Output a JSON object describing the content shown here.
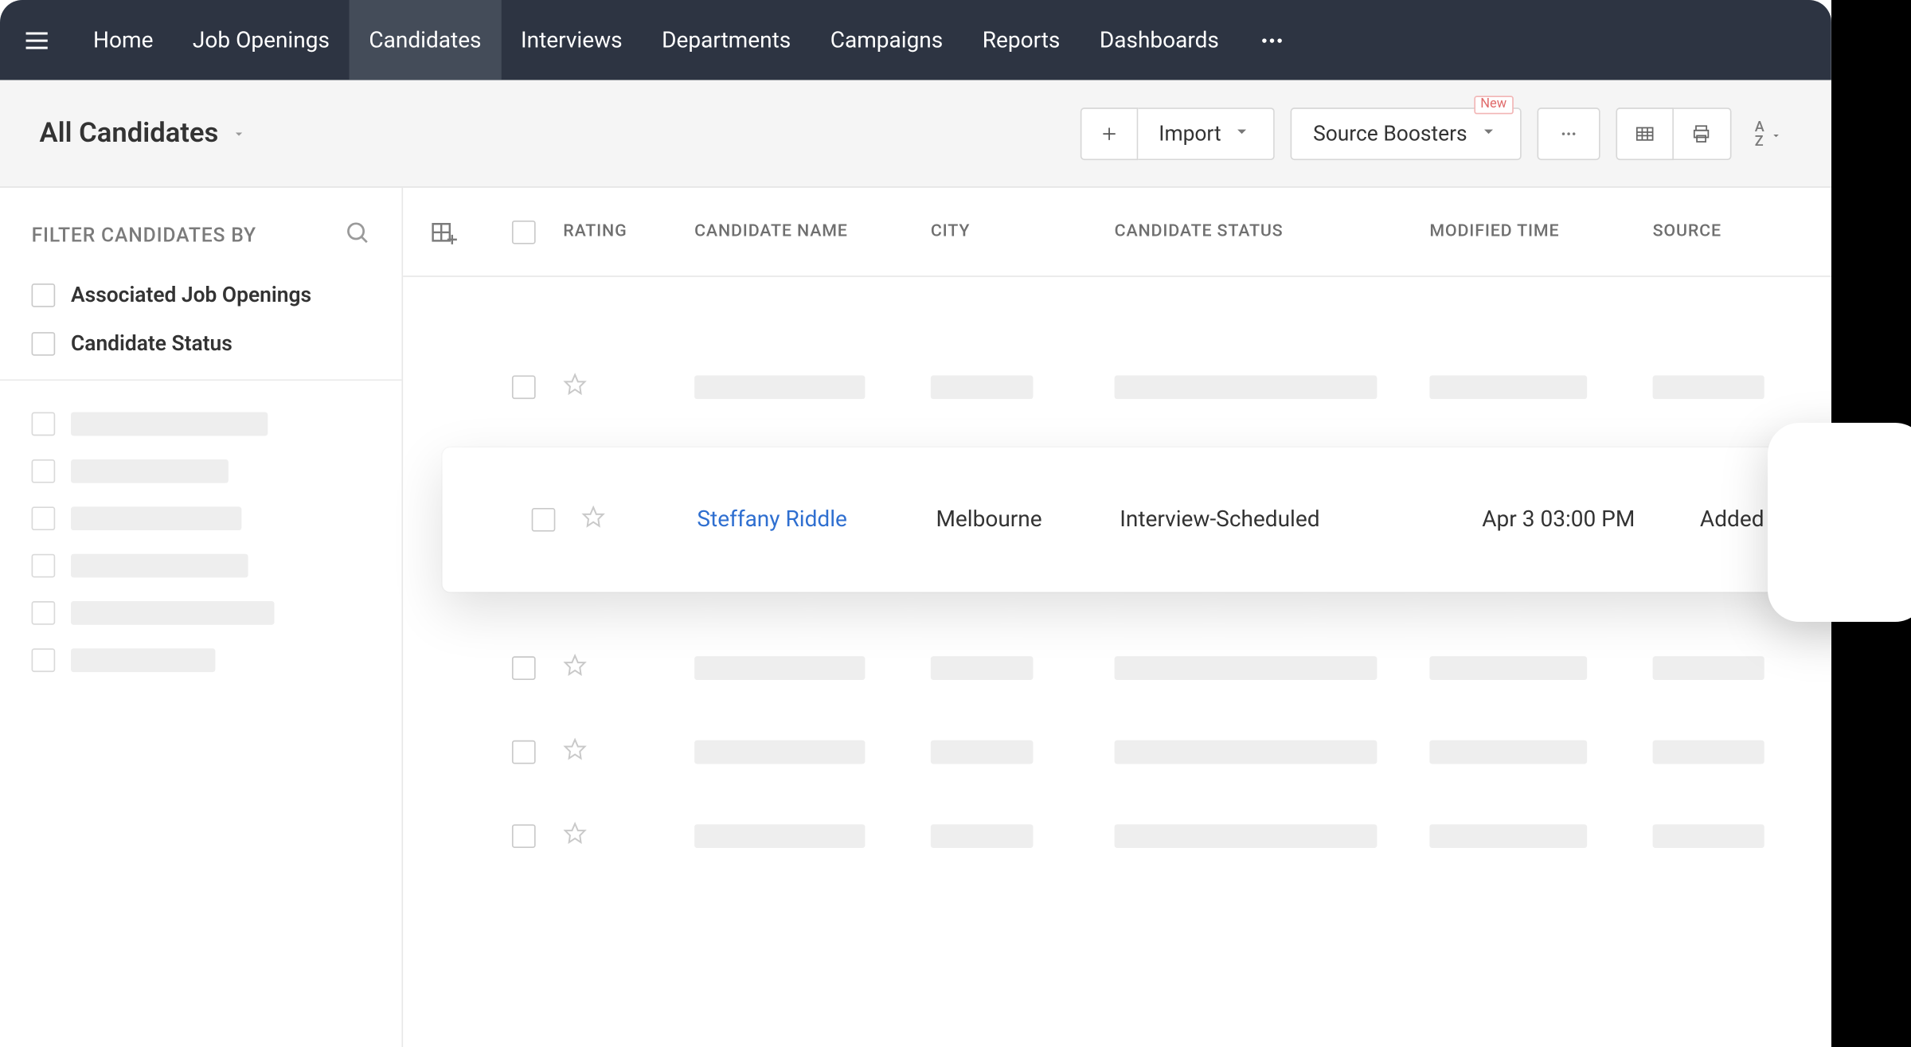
{
  "nav": {
    "items": [
      "Home",
      "Job Openings",
      "Candidates",
      "Interviews",
      "Departments",
      "Campaigns",
      "Reports",
      "Dashboards"
    ],
    "active_index": 2
  },
  "toolbar": {
    "view_title": "All Candidates",
    "import_label": "Import",
    "source_boosters_label": "Source Boosters",
    "new_badge": "New"
  },
  "sidebar": {
    "title": "FILTER CANDIDATES BY",
    "filters": [
      {
        "label": "Associated Job Openings"
      },
      {
        "label": "Candidate Status"
      }
    ],
    "ghost_filters": [
      150,
      120,
      130,
      135,
      155,
      110
    ]
  },
  "table": {
    "headers": {
      "rating": "RATING",
      "name": "CANDIDATE NAME",
      "city": "CITY",
      "status": "CANDIDATE STATUS",
      "modified": "MODIFIED TIME",
      "source": "SOURCE"
    },
    "highlighted_row": {
      "name": "Steffany Riddle",
      "city": "Melbourne",
      "status": "Interview-Scheduled",
      "modified": "Apr 3 03:00 PM",
      "source": "Added by User"
    }
  }
}
